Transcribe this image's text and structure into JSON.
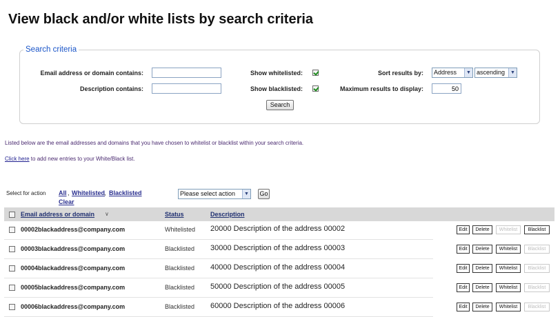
{
  "page_title": "View black and/or white lists by search criteria",
  "search": {
    "legend": "Search criteria",
    "email_label": "Email address or domain contains:",
    "email_value": "",
    "description_label": "Description contains:",
    "description_value": "",
    "show_whitelisted_label": "Show whitelisted:",
    "show_whitelisted": true,
    "show_blacklisted_label": "Show blacklisted:",
    "show_blacklisted": true,
    "sort_label": "Sort results by:",
    "sort_field": "Address",
    "sort_order": "ascending",
    "max_label": "Maximum results to display:",
    "max_value": "50",
    "search_button": "Search"
  },
  "info": {
    "listed_text": "Listed below are the email addresses and domains that you have chosen to whitelist or blacklist within your search criteria.",
    "click_here": "Click here",
    "add_text": " to add new entries to your White/Black list."
  },
  "actions": {
    "select_for_action": "Select for action",
    "all": "All",
    "whitelisted": "Whitelisted",
    "blacklisted": "Blacklisted",
    "clear": "Clear",
    "action_select": "Please select action",
    "go": "Go"
  },
  "table": {
    "headers": {
      "email": "Email address or domain",
      "sort_icon": "∨",
      "status": "Status",
      "description": "Description"
    },
    "row_buttons": {
      "edit": "Edit",
      "delete": "Delete",
      "whitelist": "Whitelist",
      "blacklist": "Blacklist"
    },
    "rows": [
      {
        "email": "00002blackaddress@company.com",
        "status": "Whitelisted",
        "description": "20000 Description of the address 00002"
      },
      {
        "email": "00003blackaddress@company.com",
        "status": "Blacklisted",
        "description": "30000 Description of the address 00003"
      },
      {
        "email": "00004blackaddress@company.com",
        "status": "Blacklisted",
        "description": "40000 Description of the address 00004"
      },
      {
        "email": "00005blackaddress@company.com",
        "status": "Blacklisted",
        "description": "50000 Description of the address 00005"
      },
      {
        "email": "00006blackaddress@company.com",
        "status": "Blacklisted",
        "description": "60000 Description of the address 00006"
      }
    ]
  }
}
